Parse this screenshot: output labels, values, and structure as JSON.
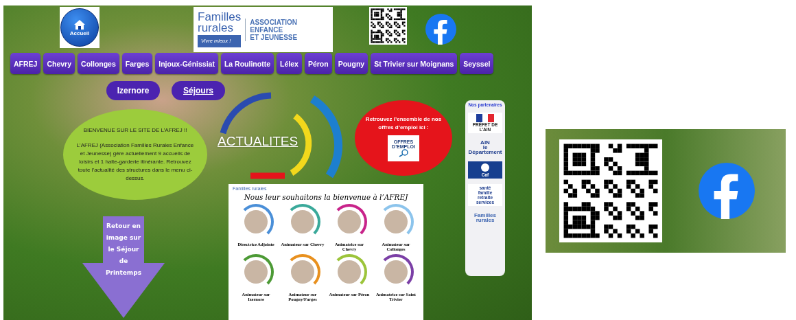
{
  "header": {
    "home_button": {
      "label": "Accueil"
    },
    "logo": {
      "brand": [
        "Familles",
        "rurales"
      ],
      "tagline": "Vivre mieux !",
      "association": [
        "ASSOCIATION",
        "ENFANCE",
        "ET JEUNESSE"
      ]
    }
  },
  "nav": [
    {
      "label": "AFREJ"
    },
    {
      "label": "Chevry"
    },
    {
      "label": "Collonges"
    },
    {
      "label": "Farges"
    },
    {
      "label": "Injoux-Génissiat"
    },
    {
      "label": "La Roulinotte"
    },
    {
      "label": "Lélex"
    },
    {
      "label": "Péron"
    },
    {
      "label": "Pougny"
    },
    {
      "label": "St Trivier sur Moignans"
    },
    {
      "label": "Seyssel"
    }
  ],
  "subnav": [
    {
      "label": "Izernore",
      "underlined": false
    },
    {
      "label": "Séjours",
      "underlined": true
    }
  ],
  "welcome": {
    "title": "BIENVENUE SUR LE SITE DE L’AFREJ !!",
    "body": "L’AFREJ (Association Familles Rurales Enfance et Jeunesse) gère actuellement 9 accueils de loisirs et 1 halte-garderie itinérante. Retrouvez toute l’actualité des structures dans le menu ci-dessus."
  },
  "news": {
    "label": "ACTUALITES"
  },
  "jobs": {
    "text": "Retrouvez l’ensemble de nos offres d’emploi ici :",
    "badge": "OFFRES D’EMPLOI"
  },
  "partners": {
    "title": "Nos partenaires",
    "logos": [
      {
        "kind": "prefet",
        "lines": [
          "PRÉFET DE L’AIN"
        ]
      },
      {
        "kind": "ain",
        "lines": [
          "AIN",
          "le Département"
        ]
      },
      {
        "kind": "caf",
        "lines": [
          "Caf"
        ]
      },
      {
        "kind": "msa",
        "lines": [
          "santé",
          "famille",
          "retraite",
          "services"
        ]
      },
      {
        "kind": "familles",
        "lines": [
          "Familles",
          "rurales"
        ]
      }
    ]
  },
  "poster": {
    "logo": "Familles rurales",
    "title": "Nous leur souhaitons la bienvenue à l’AFREJ",
    "staff": [
      {
        "role": "Directrice Adjointe",
        "color": "#4a8fd8"
      },
      {
        "role": "Animateur sur Chevry",
        "color": "#3aa99a"
      },
      {
        "role": "Animatrice sur Chevry",
        "color": "#c8238a"
      },
      {
        "role": "Animateur sur Collonges",
        "color": "#8cc4ec"
      },
      {
        "role": "Animateur sur Izernore",
        "color": "#4c9a35"
      },
      {
        "role": "Animateur sur Pougny/Farges",
        "color": "#e8901e"
      },
      {
        "role": "Animateur sur Péron",
        "color": "#9cc43a"
      },
      {
        "role": "Animatrice sur Saint Trivier",
        "color": "#7b3fa6"
      }
    ]
  },
  "arrow": {
    "text": "Retour en image sur le Séjour de Printemps"
  }
}
